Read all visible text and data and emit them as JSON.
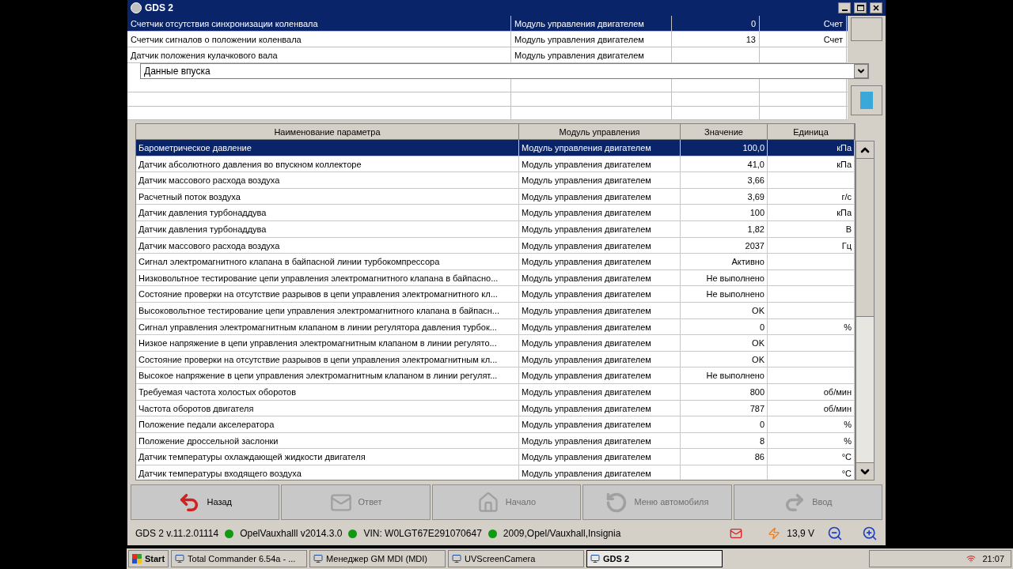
{
  "window": {
    "title": "GDS 2"
  },
  "top_table": {
    "rows": [
      {
        "name": "Счетчик отсутствия синхронизации коленвала",
        "module": "Модуль управления двигателем",
        "value": "0",
        "unit": "Счет",
        "selected": true
      },
      {
        "name": "Счетчик сигналов о положении коленвала",
        "module": "Модуль управления двигателем",
        "value": "13",
        "unit": "Счет",
        "selected": false
      },
      {
        "name": "Датчик положения кулачкового вала",
        "module": "Модуль управления двигателем",
        "value": "",
        "unit": "",
        "selected": false
      }
    ]
  },
  "dropdown": {
    "value": "Данные впуска"
  },
  "table": {
    "columns": [
      "Наименование параметра",
      "Модуль управления",
      "Значение",
      "Единица"
    ],
    "rows": [
      {
        "name": "Барометрическое давление",
        "module": "Модуль управления двигателем",
        "value": "100,0",
        "unit": "кПа",
        "selected": true
      },
      {
        "name": "Датчик абсолютного давления во впускном коллекторе",
        "module": "Модуль управления двигателем",
        "value": "41,0",
        "unit": "кПа",
        "selected": false
      },
      {
        "name": "Датчик массового расхода воздуха",
        "module": "Модуль управления двигателем",
        "value": "3,66",
        "unit": "",
        "selected": false
      },
      {
        "name": "Расчетный поток воздуха",
        "module": "Модуль управления двигателем",
        "value": "3,69",
        "unit": "г/с",
        "selected": false
      },
      {
        "name": "Датчик давления турбонаддува",
        "module": "Модуль управления двигателем",
        "value": "100",
        "unit": "кПа",
        "selected": false
      },
      {
        "name": "Датчик давления турбонаддува",
        "module": "Модуль управления двигателем",
        "value": "1,82",
        "unit": "В",
        "selected": false
      },
      {
        "name": "Датчик массового расхода воздуха",
        "module": "Модуль управления двигателем",
        "value": "2037",
        "unit": "Гц",
        "selected": false
      },
      {
        "name": "Сигнал электромагнитного клапана в байпасной линии турбокомпрессора",
        "module": "Модуль управления двигателем",
        "value": "Активно",
        "unit": "",
        "selected": false
      },
      {
        "name": "Низковольтное тестирование цепи управления электромагнитного клапана в байпасно...",
        "module": "Модуль управления двигателем",
        "value": "Не выполнено",
        "unit": "",
        "selected": false
      },
      {
        "name": "Состояние проверки на отсутствие разрывов в цепи управления электромагнитного кл...",
        "module": "Модуль управления двигателем",
        "value": "Не выполнено",
        "unit": "",
        "selected": false
      },
      {
        "name": "Высоковольтное тестирование цепи управления электромагнитного клапана в байпасн...",
        "module": "Модуль управления двигателем",
        "value": "OK",
        "unit": "",
        "selected": false
      },
      {
        "name": "Сигнал управления электромагнитным клапаном в линии регулятора давления турбок...",
        "module": "Модуль управления двигателем",
        "value": "0",
        "unit": "%",
        "selected": false
      },
      {
        "name": "Низкое напряжение в цепи управления электромагнитным клапаном в линии регулято...",
        "module": "Модуль управления двигателем",
        "value": "OK",
        "unit": "",
        "selected": false
      },
      {
        "name": "Состояние проверки на отсутствие разрывов в цепи управления электромагнитным кл...",
        "module": "Модуль управления двигателем",
        "value": "OK",
        "unit": "",
        "selected": false
      },
      {
        "name": "Высокое напряжение в цепи управления электромагнитным клапаном в линии регулят...",
        "module": "Модуль управления двигателем",
        "value": "Не выполнено",
        "unit": "",
        "selected": false
      },
      {
        "name": "Требуемая частота холостых оборотов",
        "module": "Модуль управления двигателем",
        "value": "800",
        "unit": "об/мин",
        "selected": false
      },
      {
        "name": "Частота оборотов двигателя",
        "module": "Модуль управления двигателем",
        "value": "787",
        "unit": "об/мин",
        "selected": false
      },
      {
        "name": "Положение педали акселератора",
        "module": "Модуль управления двигателем",
        "value": "0",
        "unit": "%",
        "selected": false
      },
      {
        "name": "Положение дроссельной заслонки",
        "module": "Модуль управления двигателем",
        "value": "8",
        "unit": "%",
        "selected": false
      },
      {
        "name": "Датчик температуры охлаждающей жидкости двигателя",
        "module": "Модуль управления двигателем",
        "value": "86",
        "unit": "°C",
        "selected": false
      },
      {
        "name": "Датчик температуры входящего воздуха",
        "module": "Модуль управления двигателем",
        "value": "",
        "unit": "°C",
        "selected": false
      }
    ]
  },
  "nav_buttons": [
    {
      "kind": "back",
      "label": "Назад",
      "disabled": false
    },
    {
      "kind": "answer",
      "label": "Ответ",
      "disabled": true
    },
    {
      "kind": "home",
      "label": "Начало",
      "disabled": true
    },
    {
      "kind": "vehicle_menu",
      "label": "Меню автомобиля",
      "disabled": true
    },
    {
      "kind": "enter",
      "label": "Ввод",
      "disabled": true
    }
  ],
  "status_bar": {
    "version": "GDS 2 v.11.2.01114",
    "items": [
      {
        "text": "OpelVauxhalll v2014.3.0",
        "color": "#119911"
      },
      {
        "text": "VIN: W0LGT67E291070647",
        "color": "#119911"
      },
      {
        "text": "2009,Opel/Vauxhall,Insignia",
        "color": "#119911"
      }
    ],
    "voltage": "13,9 V"
  },
  "taskbar": {
    "start": "Start",
    "items": [
      {
        "label": "Total Commander 6.54a - ...",
        "selected": false
      },
      {
        "label": "Менеджер GM MDI (MDI)",
        "selected": false
      },
      {
        "label": "UVScreenCamera",
        "selected": false
      },
      {
        "label": "GDS 2",
        "selected": true
      }
    ],
    "clock": "21:07"
  }
}
